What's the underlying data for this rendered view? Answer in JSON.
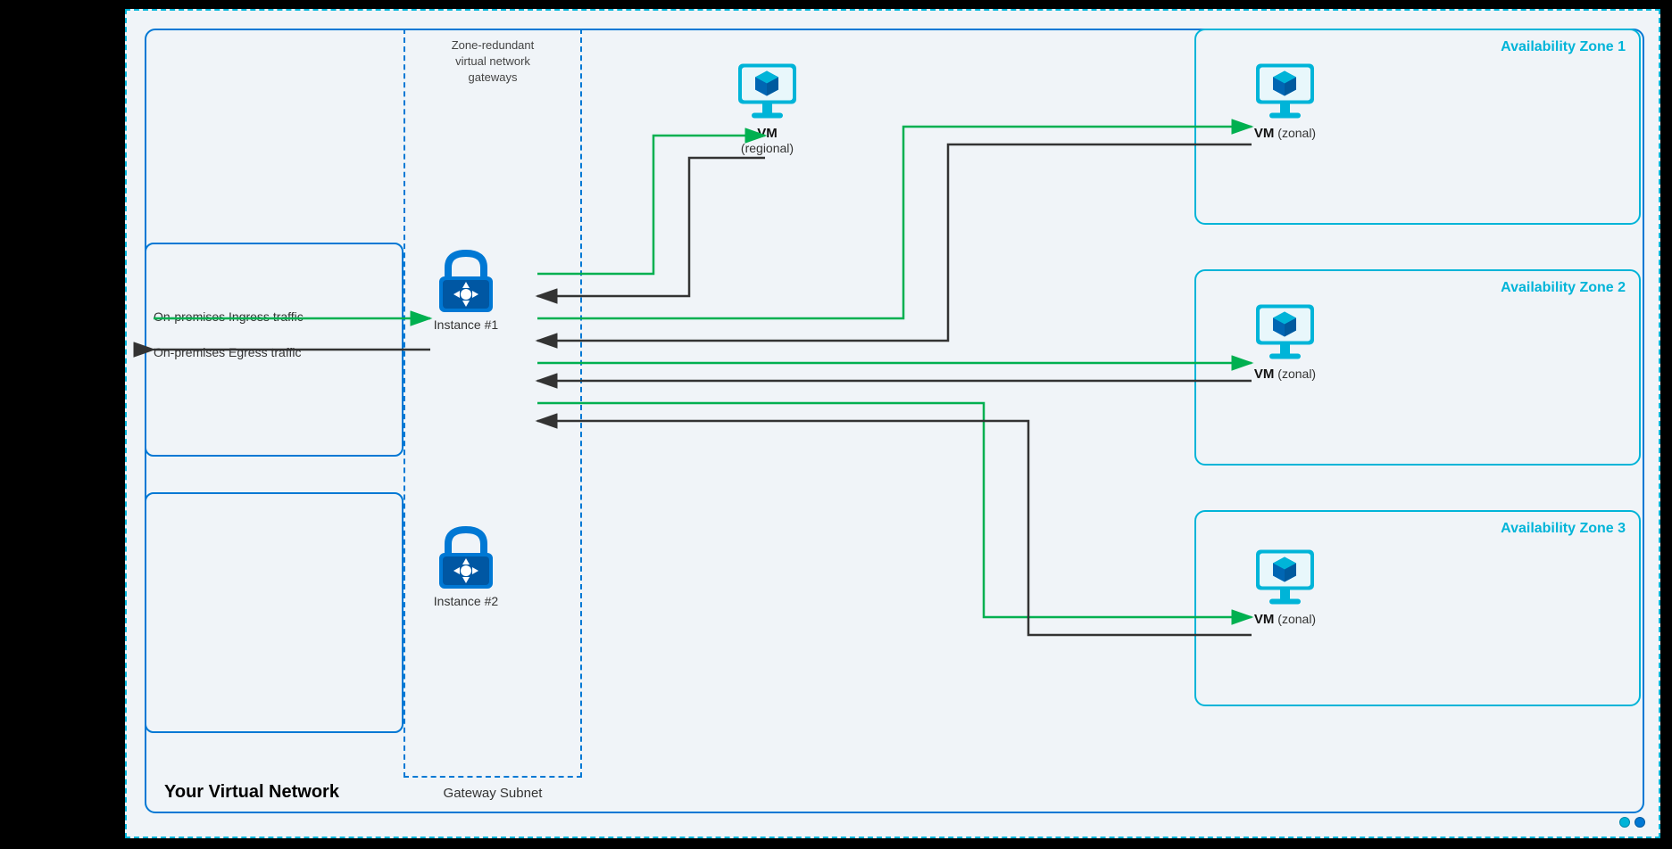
{
  "diagram": {
    "title": "Your Virtual Network",
    "gateway_subnet_label": "Gateway Subnet",
    "zone_redundant_label": "Zone-redundant\nvirtual network\ngateways",
    "zones": [
      {
        "label": "Availability Zone 1"
      },
      {
        "label": "Availability Zone 2"
      },
      {
        "label": "Availability Zone 3"
      }
    ],
    "instances": [
      {
        "label": "Instance #1"
      },
      {
        "label": "Instance #2"
      }
    ],
    "vms": [
      {
        "label": "VM",
        "sublabel": "(regional)"
      },
      {
        "label": "VM",
        "sublabel": "(zonal)"
      },
      {
        "label": "VM",
        "sublabel": "(zonal)"
      },
      {
        "label": "VM",
        "sublabel": "(zonal)"
      }
    ],
    "traffic": [
      {
        "label": "On-premises Ingress traffic"
      },
      {
        "label": "On-premises Egress traffic"
      }
    ]
  },
  "colors": {
    "blue_primary": "#0078d4",
    "cyan_border": "#00b4d8",
    "green_arrow": "#00b050",
    "dark_arrow": "#333333",
    "lock_blue": "#0078d4",
    "vm_cyan": "#00b4d8"
  },
  "dots": [
    {
      "color": "#00b4d8"
    },
    {
      "color": "#0078d4"
    }
  ]
}
